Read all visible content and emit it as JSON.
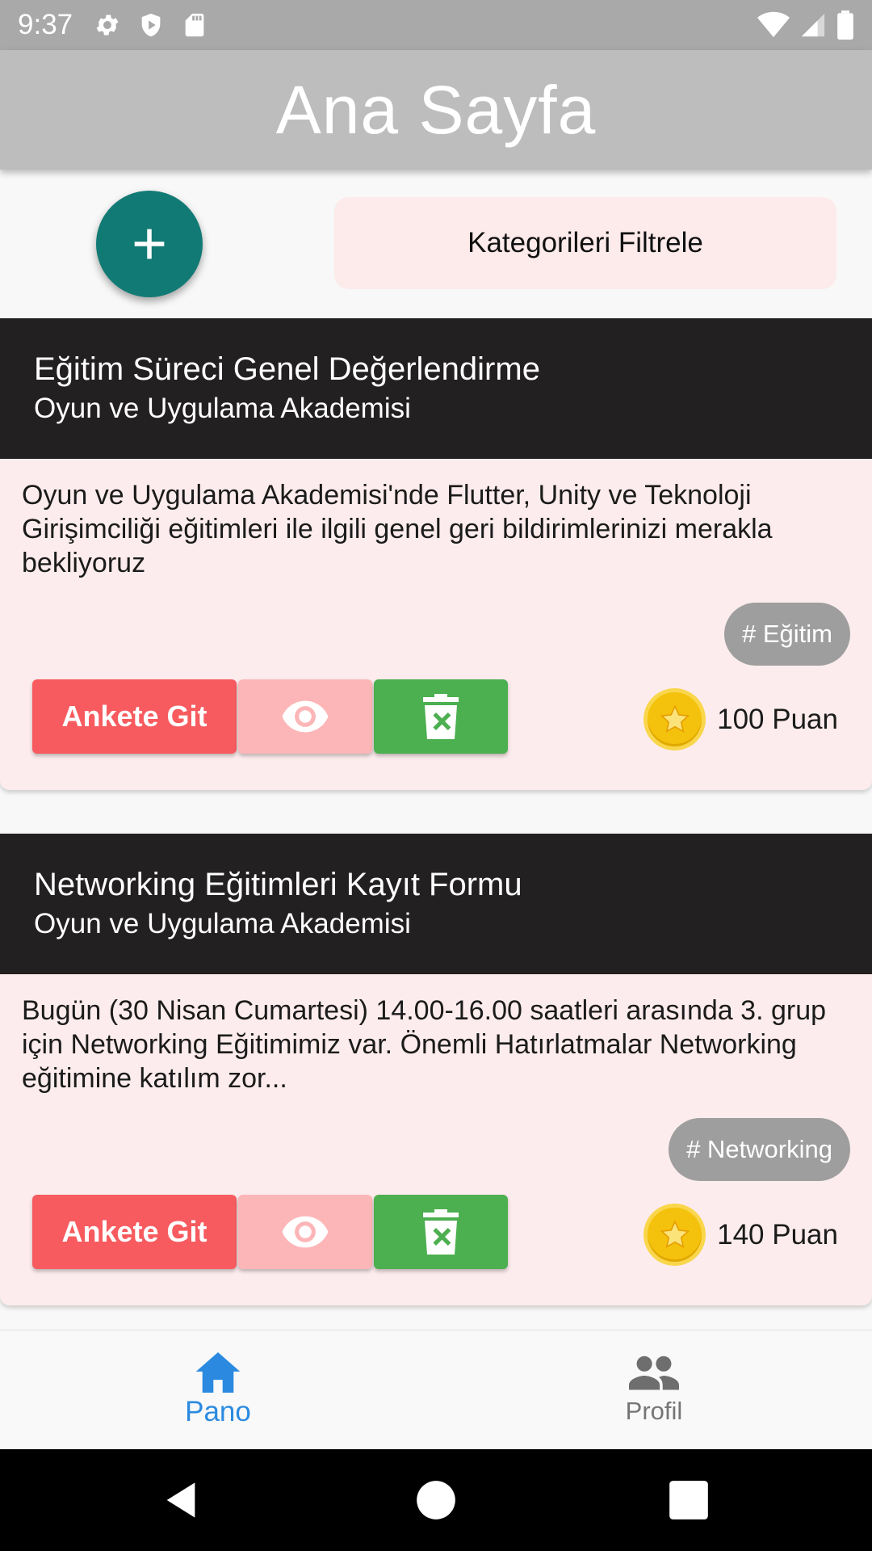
{
  "status_bar": {
    "time": "9:37",
    "icons": [
      "gear-icon",
      "shield-icon",
      "sd-card-icon",
      "wifi-icon",
      "signal-icon",
      "battery-icon"
    ]
  },
  "app_bar": {
    "title": "Ana Sayfa"
  },
  "controls": {
    "add_icon": "plus-icon",
    "filter_label": "Kategorileri Filtrele"
  },
  "surveys": [
    {
      "title": "Eğitim Süreci Genel Değerlendirme",
      "organization": "Oyun ve Uygulama Akademisi",
      "description": "Oyun ve Uygulama Akademisi'nde Flutter, Unity ve Teknoloji Girişimciliği eğitimleri ile ilgili genel geri bildirimlerinizi merakla bekliyoruz",
      "tag": "# Eğitim",
      "go_label": "Ankete Git",
      "points": "100 Puan"
    },
    {
      "title": "Networking Eğitimleri Kayıt Formu",
      "organization": "Oyun ve Uygulama Akademisi",
      "description": "Bugün (30 Nisan Cumartesi) 14.00-16.00 saatleri arasında 3. grup için Networking Eğitimimiz var. Önemli Hatırlatmalar Networking eğitimine katılım zor...",
      "tag": "# Networking",
      "go_label": "Ankete Git",
      "points": "140 Puan"
    }
  ],
  "bottom_nav": {
    "items": [
      {
        "label": "Pano",
        "icon": "home-icon",
        "active": true
      },
      {
        "label": "Profil",
        "icon": "people-icon",
        "active": false
      }
    ]
  },
  "colors": {
    "accent_teal": "#127a74",
    "go_button": "#f75b5f",
    "view_button": "#fdb6b8",
    "delete_button": "#4caf50",
    "card_header": "#222021",
    "card_body": "#fdeced",
    "nav_active": "#2b8ae0"
  }
}
